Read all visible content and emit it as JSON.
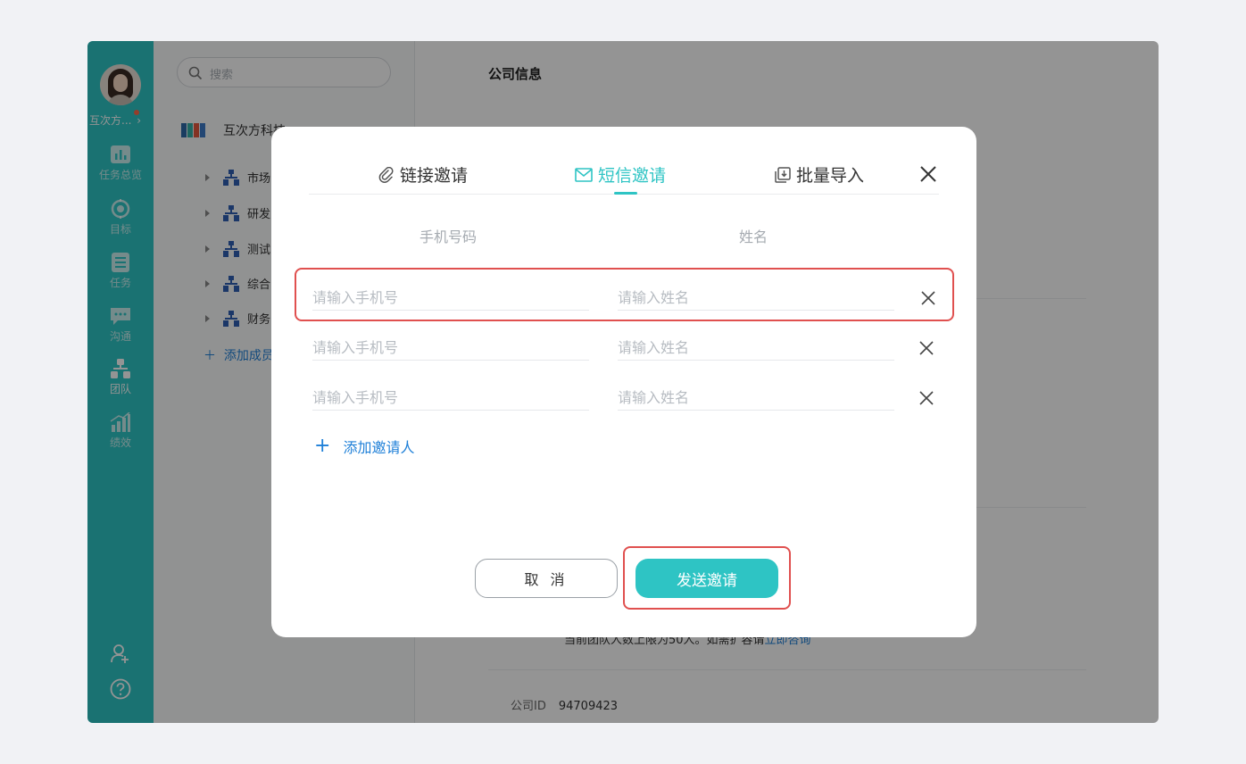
{
  "rail": {
    "team_name": "互次方...",
    "nav": [
      {
        "label": "任务总览",
        "icon": "bar-chart-icon"
      },
      {
        "label": "目标",
        "icon": "target-icon"
      },
      {
        "label": "任务",
        "icon": "task-list-icon"
      },
      {
        "label": "沟通",
        "icon": "chat-icon"
      },
      {
        "label": "团队",
        "icon": "org-chart-icon",
        "active": true
      },
      {
        "label": "绩效",
        "icon": "growth-chart-icon"
      }
    ],
    "bottom_icons": [
      "add-user-icon",
      "help-icon"
    ]
  },
  "sidebar": {
    "search_placeholder": "搜索",
    "company_name": "互次方科技",
    "departments": [
      "市场",
      "研发",
      "测试",
      "综合",
      "财务"
    ],
    "add_member": "添加成员"
  },
  "content": {
    "title": "公司信息",
    "limit_text": "当前团队人数上限为50人。如需扩容请",
    "limit_link": "立即咨询",
    "company_id_label": "公司ID",
    "company_id_value": "94709423"
  },
  "modal": {
    "tabs": [
      {
        "label": "链接邀请",
        "icon": "paperclip-icon"
      },
      {
        "label": "短信邀请",
        "icon": "mail-icon",
        "active": true
      },
      {
        "label": "批量导入",
        "icon": "import-icon"
      }
    ],
    "columns": {
      "phone": "手机号码",
      "name": "姓名"
    },
    "rows": [
      {
        "phone_placeholder": "请输入手机号",
        "name_placeholder": "请输入姓名"
      },
      {
        "phone_placeholder": "请输入手机号",
        "name_placeholder": "请输入姓名"
      },
      {
        "phone_placeholder": "请输入手机号",
        "name_placeholder": "请输入姓名"
      }
    ],
    "add_inviter": "添加邀请人",
    "cancel": "取 消",
    "send": "发送邀请"
  },
  "colors": {
    "accent": "#2ec4c4",
    "link": "#1f80d8",
    "highlight": "#e0504f"
  }
}
